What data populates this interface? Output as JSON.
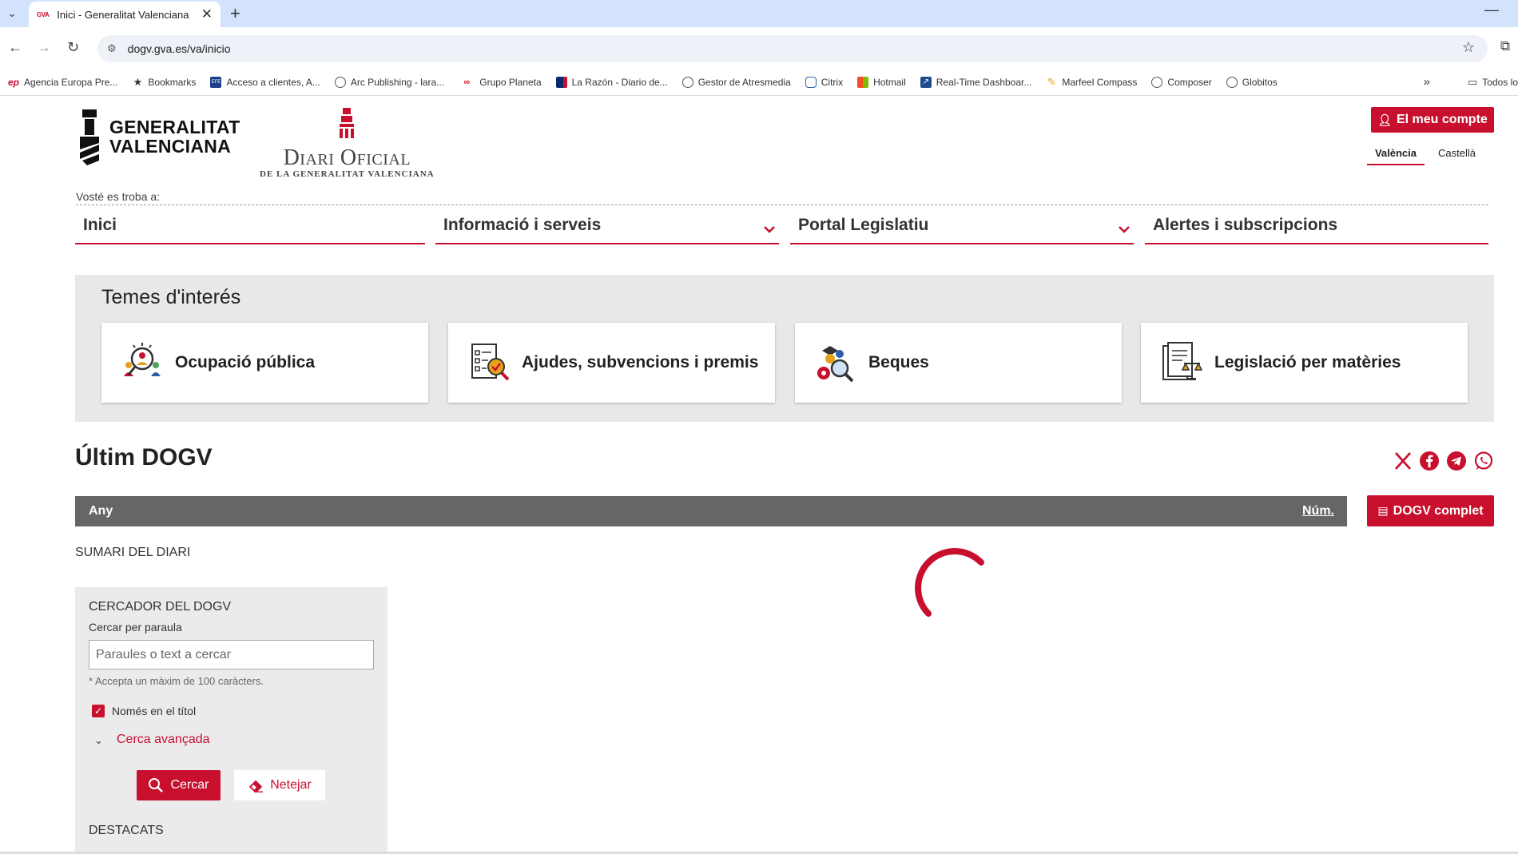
{
  "browser": {
    "tab_title": "Inici - Generalitat Valenciana",
    "tab_favicon": "GVA",
    "url": "dogv.gva.es/va/inicio",
    "bookmarks": [
      {
        "label": "Agencia Europa Pre...",
        "icon": "ep"
      },
      {
        "label": "Bookmarks",
        "icon": "★"
      },
      {
        "label": "Acceso a clientes, A...",
        "icon": "EFE"
      },
      {
        "label": "Arc Publishing - lara...",
        "icon": "globe"
      },
      {
        "label": "Grupo Planeta",
        "icon": "planeta"
      },
      {
        "label": "La Razón - Diario de...",
        "icon": "razon"
      },
      {
        "label": "Gestor de Atresmedia",
        "icon": "globe"
      },
      {
        "label": "Citrix",
        "icon": "citrix"
      },
      {
        "label": "Hotmail",
        "icon": "ms"
      },
      {
        "label": "Real-Time Dashboar...",
        "icon": "rt"
      },
      {
        "label": "Marfeel Compass",
        "icon": "marfeel"
      },
      {
        "label": "Composer",
        "icon": "globe"
      },
      {
        "label": "Globitos",
        "icon": "globe"
      }
    ],
    "bookmarks_all": "Todos lo",
    "colors": {
      "tabstrip": "#d3e3fd"
    }
  },
  "header": {
    "gv_logo_line1": "GENERALITAT",
    "gv_logo_line2": "VALENCIANA",
    "diari_title": "Diari Oficial",
    "diari_sub": "DE LA GENERALITAT VALENCIANA",
    "account_button": "El meu compte",
    "lang_va": "València",
    "lang_es": "Castellà",
    "breadcrumb": "Vosté es troba a:"
  },
  "nav": {
    "items": [
      {
        "label": "Inici",
        "dropdown": false
      },
      {
        "label": "Informació i serveis",
        "dropdown": true
      },
      {
        "label": "Portal Legislatiu",
        "dropdown": true
      },
      {
        "label": "Alertes i subscripcions",
        "dropdown": false
      }
    ]
  },
  "interes": {
    "title": "Temes d'interés",
    "cards": [
      {
        "label": "Ocupació pública",
        "icon": "people-search-icon"
      },
      {
        "label": "Ajudes, subvencions i premis",
        "icon": "checklist-search-icon"
      },
      {
        "label": "Beques",
        "icon": "gear-search-icon"
      },
      {
        "label": "Legislació per matèries",
        "icon": "legal-document-icon"
      }
    ]
  },
  "ultim": {
    "title": "Últim DOGV",
    "share": [
      "x-icon",
      "facebook-icon",
      "telegram-icon",
      "whatsapp-icon"
    ],
    "any_label": "Any",
    "num_label": "Núm.",
    "dogv_button": "DOGV complet",
    "sumari": "SUMARI DEL DIARI"
  },
  "cercador": {
    "title": "CERCADOR DEL DOGV",
    "label": "Cercar per paraula",
    "placeholder": "Paraules o text a cercar",
    "hint": "* Accepta un màxim de 100 caràcters.",
    "only_title_label": "Només en el títol",
    "only_title_checked": true,
    "advanced": "Cerca avançada",
    "search_button": "Cercar",
    "clear_button": "Netejar",
    "destacats": "DESTACATS"
  },
  "colors": {
    "accent": "#c8102e",
    "bar": "#666666",
    "panel": "#e8e8e8"
  }
}
